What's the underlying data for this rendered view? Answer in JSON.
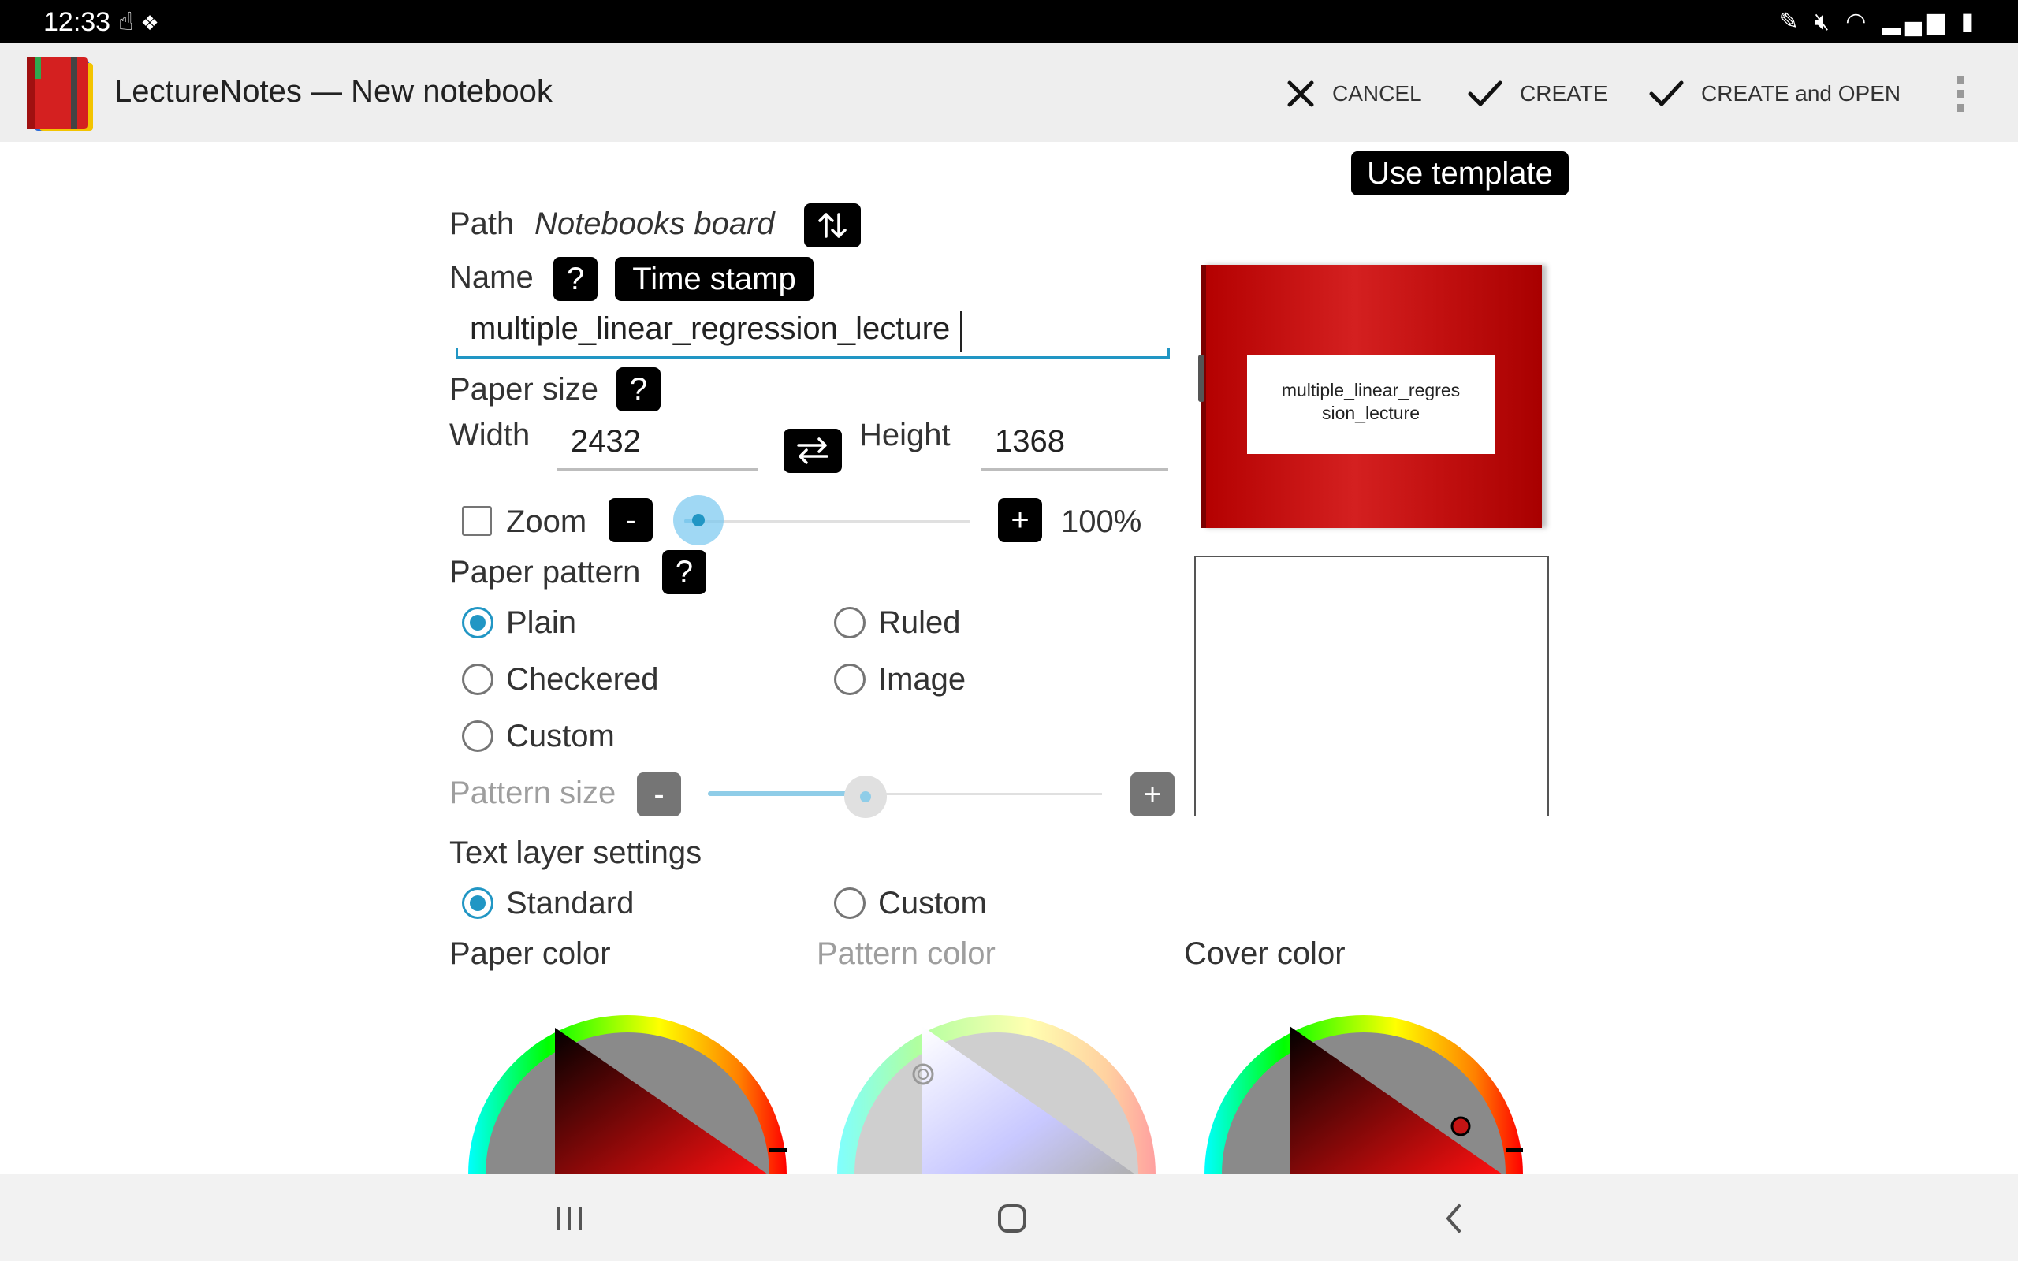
{
  "status_bar": {
    "time": "12:33",
    "left_icons": [
      "touch-icon",
      "dropbox-icon"
    ],
    "right_icons": [
      "pen-icon",
      "mute-icon",
      "wifi-icon",
      "signal-icon",
      "battery-icon"
    ]
  },
  "app_bar": {
    "title": "LectureNotes — New notebook",
    "actions": {
      "cancel": "CANCEL",
      "create": "CREATE",
      "create_open": "CREATE and OPEN"
    }
  },
  "form": {
    "use_template": "Use template",
    "path_label": "Path",
    "path_value": "Notebooks board",
    "name_label": "Name",
    "help": "?",
    "time_stamp": "Time stamp",
    "name_value": "multiple_linear_regression_lecture",
    "paper_size_label": "Paper size",
    "width_label": "Width",
    "width_value": "2432",
    "height_label": "Height",
    "height_value": "1368",
    "zoom_label": "Zoom",
    "zoom_minus": "-",
    "zoom_plus": "+",
    "zoom_value": "100%",
    "zoom_level": 0.05,
    "paper_pattern_label": "Paper pattern",
    "patterns": {
      "plain": "Plain",
      "ruled": "Ruled",
      "checkered": "Checkered",
      "image": "Image",
      "custom": "Custom"
    },
    "selected_pattern": "plain",
    "pattern_size_label": "Pattern size",
    "pattern_minus": "-",
    "pattern_plus": "+",
    "pattern_level": 0.4,
    "text_layer_label": "Text layer settings",
    "text_layer": {
      "standard": "Standard",
      "custom": "Custom"
    },
    "selected_text_layer": "standard",
    "paper_color_label": "Paper color",
    "pattern_color_label": "Pattern color",
    "cover_color_label": "Cover color"
  },
  "cover_preview": {
    "label": "multiple_linear_regression_lecture",
    "color": "#c41414"
  },
  "nav_bar": {
    "buttons": [
      "recent-apps-icon",
      "home-icon",
      "back-icon"
    ]
  }
}
